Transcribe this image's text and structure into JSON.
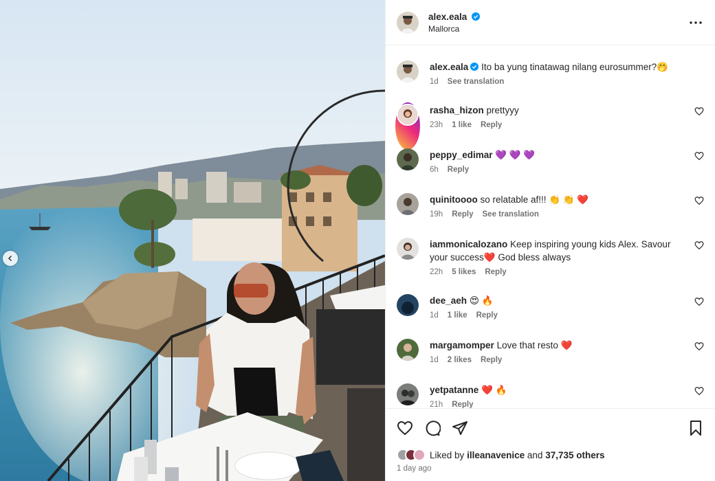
{
  "post": {
    "username": "alex.eala",
    "location": "Mallorca",
    "caption": "Ito ba yung tinatawag nilang eurosummer?",
    "caption_emoji": "🤭",
    "caption_time": "1d",
    "see_translation": "See translation"
  },
  "icons": {
    "verified": "verified-badge-icon",
    "more": "more-options-icon",
    "like": "heart-icon",
    "comment": "comment-icon",
    "share": "share-icon",
    "save": "bookmark-icon",
    "carousel_prev": "chevron-left-icon"
  },
  "colors": {
    "verified_blue": "#0095f6",
    "emoji_heart": "#ee1d52",
    "emoji_purple": "#8a2be2"
  },
  "comments": [
    {
      "username": "rasha_hizon",
      "text": "prettyyy",
      "time": "23h",
      "likes": "1 like",
      "reply": "Reply",
      "translation": ""
    },
    {
      "username": "peppy_edimar",
      "text": "💜 💜 💜",
      "time": "6h",
      "likes": "",
      "reply": "Reply",
      "translation": ""
    },
    {
      "username": "quinitoooo",
      "text": "so relatable af!!! 👏 👏 ❤️",
      "time": "19h",
      "likes": "",
      "reply": "Reply",
      "translation": "See translation"
    },
    {
      "username": "iammonicalozano",
      "text": "Keep inspiring young kids Alex. Savour your success❤️ God bless always",
      "time": "22h",
      "likes": "5 likes",
      "reply": "Reply",
      "translation": ""
    },
    {
      "username": "dee_aeh",
      "text": "😍 🔥",
      "time": "1d",
      "likes": "1 like",
      "reply": "Reply",
      "translation": ""
    },
    {
      "username": "margamomper",
      "text": "Love that resto ❤️",
      "time": "1d",
      "likes": "2 likes",
      "reply": "Reply",
      "translation": ""
    },
    {
      "username": "yetpatanne",
      "text": "❤️ 🔥",
      "time": "21h",
      "likes": "",
      "reply": "Reply",
      "translation": ""
    }
  ],
  "footer": {
    "liked_by_prefix": "Liked by",
    "liked_by_user": "illeanavenice",
    "liked_by_and": "and",
    "others": "37,735 others",
    "posted": "1 day ago"
  }
}
